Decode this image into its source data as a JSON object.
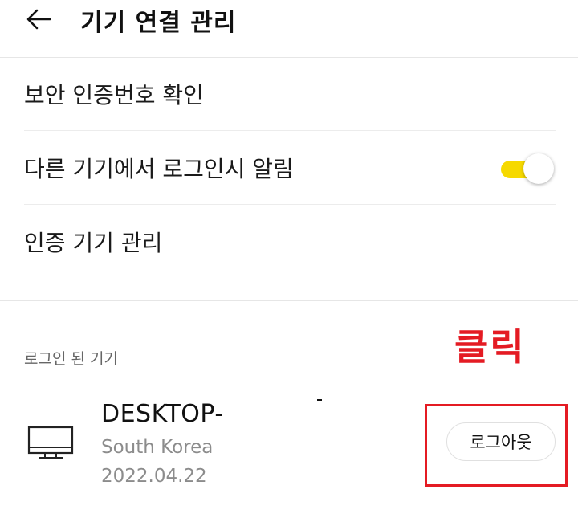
{
  "header": {
    "title": "기기 연결 관리",
    "back_icon": "arrow-left-icon"
  },
  "menu": {
    "items": [
      {
        "label": "보안 인증번호 확인"
      },
      {
        "label": "다른 기기에서 로그인시 알림",
        "toggle": {
          "on": true
        }
      },
      {
        "label": "인증 기기 관리"
      }
    ]
  },
  "logged_in": {
    "section_label": "로그인 된 기기",
    "devices": [
      {
        "name": "DESKTOP-",
        "location": "South Korea",
        "date": "2022.04.22",
        "icon": "desktop-monitor-icon",
        "logout_label": "로그아웃"
      }
    ]
  },
  "annotation": {
    "text": "클릭",
    "color": "#e41b23"
  },
  "colors": {
    "accent": "#f6d900",
    "annotation": "#e41b23",
    "secondary_text": "#8c8c8c"
  }
}
